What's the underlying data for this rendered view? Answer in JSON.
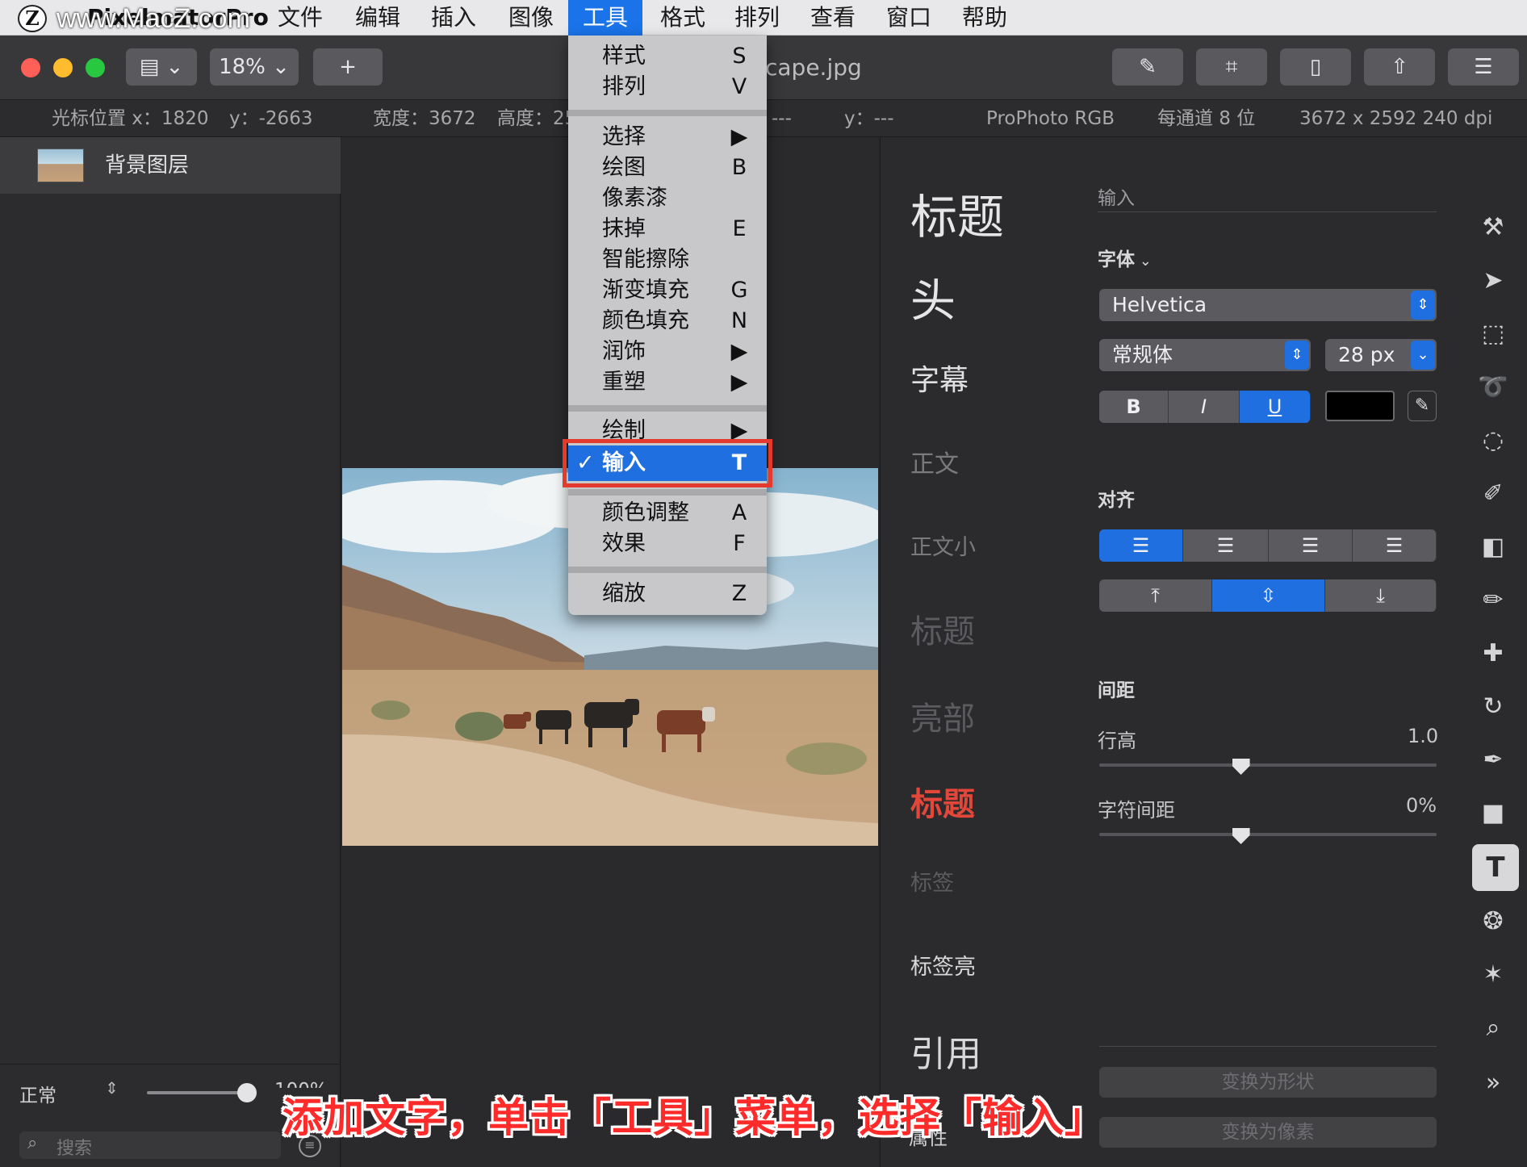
{
  "menubar": {
    "app_name": "PixelmatorPro",
    "items": [
      "文件",
      "编辑",
      "插入",
      "图像",
      "工具",
      "格式",
      "排列",
      "查看",
      "窗口",
      "帮助"
    ],
    "active": "工具"
  },
  "watermark": {
    "logo": "Z",
    "text": "www.MacZ.com"
  },
  "toolbar": {
    "zoom": "18%",
    "add": "+",
    "doc_title": "cape.jpg",
    "accent": "#1f6fe0"
  },
  "infobar": {
    "cursor_x_label": "光标位置 x：",
    "cursor_x": "1820",
    "cursor_y_label": "y：",
    "cursor_y": "-2663",
    "width_label": "宽度：",
    "width": "3672",
    "height_label": "高度：",
    "height_partial": "25",
    "sel_x": "---",
    "sel_y_label": "y：",
    "sel_y": "---",
    "color_profile": "ProPhoto RGB",
    "bit_depth": "每通道 8 位",
    "resolution": "3672 x 2592 240 dpi"
  },
  "layers": {
    "items": [
      {
        "name": "背景图层"
      }
    ],
    "blend_mode": "正常",
    "opacity": "100%",
    "search_placeholder": "搜索"
  },
  "tools_menu": {
    "items": [
      {
        "label": "样式",
        "key": "S"
      },
      {
        "label": "排列",
        "key": "V"
      },
      {
        "label": "选择",
        "key": "▶"
      },
      {
        "label": "绘图",
        "key": "B"
      },
      {
        "label": "像素漆",
        "key": ""
      },
      {
        "label": "抹掉",
        "key": "E"
      },
      {
        "label": "智能擦除",
        "key": ""
      },
      {
        "label": "渐变填充",
        "key": "G"
      },
      {
        "label": "颜色填充",
        "key": "N"
      },
      {
        "label": "润饰",
        "key": "▶"
      },
      {
        "label": "重塑",
        "key": "▶"
      },
      {
        "label": "绘制",
        "key": "▶"
      },
      {
        "label": "输入",
        "key": "T",
        "checked": true
      },
      {
        "label": "颜色调整",
        "key": "A"
      },
      {
        "label": "效果",
        "key": "F"
      },
      {
        "label": "缩放",
        "key": "Z"
      }
    ],
    "checkmark": "✓"
  },
  "text_styles": [
    {
      "label": "标题",
      "color": "#e6e6e8"
    },
    {
      "label": "头",
      "color": "#e6e6e8"
    },
    {
      "label": "字幕",
      "color": "#e0e0e2"
    },
    {
      "label": "正文",
      "color": "#7a7a7d"
    },
    {
      "label": "正文小",
      "color": "#7a7a7d"
    },
    {
      "label": "标题",
      "color": "#5c5c60"
    },
    {
      "label": "亮部",
      "color": "#5c5c60"
    },
    {
      "label": "标题",
      "color": "#e2473a"
    },
    {
      "label": "标签",
      "color": "#5c5c60"
    },
    {
      "label": "标签亮",
      "color": "#d8d8da"
    },
    {
      "label": "引用",
      "color": "#d8d8da"
    }
  ],
  "inspector": {
    "input_label": "输入",
    "font_heading": "字体",
    "font_family": "Helvetica",
    "font_style": "常规体",
    "font_size": "28 px",
    "bold": "B",
    "italic": "I",
    "underline": "U",
    "text_color": "#000000",
    "align_heading": "对齐",
    "spacing_heading": "间距",
    "line_height_label": "行高",
    "line_height_value": "1.0",
    "line_height_level": 0.42,
    "char_spacing_label": "字符间距",
    "char_spacing_value": "0%",
    "char_spacing_level": 0.42,
    "convert_shape": "变换为形状",
    "convert_pixels": "变换为像素",
    "properties": "属性"
  },
  "tool_strip": {
    "icons": [
      "style-brush-icon",
      "arrow-select-icon",
      "rect-select-icon",
      "lasso-icon",
      "quick-select-icon",
      "paint-brush-icon",
      "gradient-icon",
      "eraser-icon",
      "bandage-icon",
      "rotate-icon",
      "pen-icon",
      "shape-icon",
      "type-icon",
      "color-adjust-icon",
      "effects-icon",
      "zoom-icon"
    ],
    "selected": "type-icon",
    "more": "»"
  },
  "caption": "添加文字，单击「工具」菜单，选择「输入」"
}
